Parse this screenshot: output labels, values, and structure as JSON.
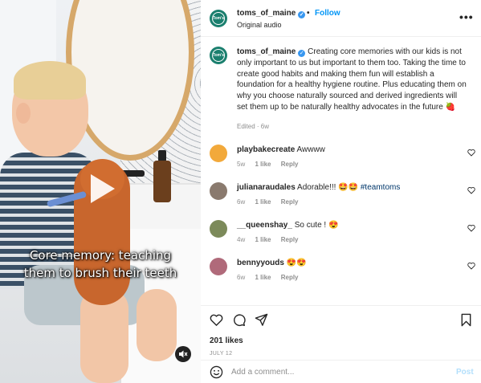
{
  "video": {
    "caption_line1": "Core memory: teaching",
    "caption_line2": "them to brush their teeth"
  },
  "header": {
    "username": "toms_of_maine",
    "dot": "•",
    "follow_label": "Follow",
    "subtitle": "Original audio",
    "more_label": "•••",
    "avatar_text": "Tom's"
  },
  "post": {
    "username": "toms_of_maine",
    "caption": "Creating core memories with our kids is not only important to us but important to them too. Taking the time to create good habits and making them fun will establish a foundation for a healthy hygiene routine. Plus educating them on why you choose naturally sourced and derived ingredients will set them up to be naturally healthy advocates in the future 🍓",
    "meta": "Edited · 6w"
  },
  "comments": [
    {
      "user": "playbakecreate",
      "text": "Awwww",
      "hashtag": "",
      "age": "5w",
      "likes": "1 like",
      "reply": "Reply",
      "avatar_color": "#f2a93b"
    },
    {
      "user": "julianaraudales",
      "text": "Adorable!!! 🤩🤩",
      "hashtag": "#teamtoms",
      "age": "6w",
      "likes": "1 like",
      "reply": "Reply",
      "avatar_color": "#8a7a6e"
    },
    {
      "user": "__queenshay_",
      "text": "So cute ! 😍",
      "hashtag": "",
      "age": "4w",
      "likes": "1 like",
      "reply": "Reply",
      "avatar_color": "#7c8a5a"
    },
    {
      "user": "bennyyouds",
      "text": "😍😍",
      "hashtag": "",
      "age": "6w",
      "likes": "1 like",
      "reply": "Reply",
      "avatar_color": "#b06a7a"
    }
  ],
  "actions": {
    "likes": "201 likes",
    "date": "JULY 12"
  },
  "composer": {
    "placeholder": "Add a comment...",
    "post_label": "Post"
  },
  "colors": {
    "brand": "#1a7f6e",
    "link": "#0095f6",
    "muted": "#8e8e8e"
  },
  "icons": [
    "play-icon",
    "mute-icon",
    "verified-icon",
    "more-icon",
    "heart-icon",
    "comment-icon",
    "share-icon",
    "bookmark-icon",
    "emoji-icon"
  ]
}
